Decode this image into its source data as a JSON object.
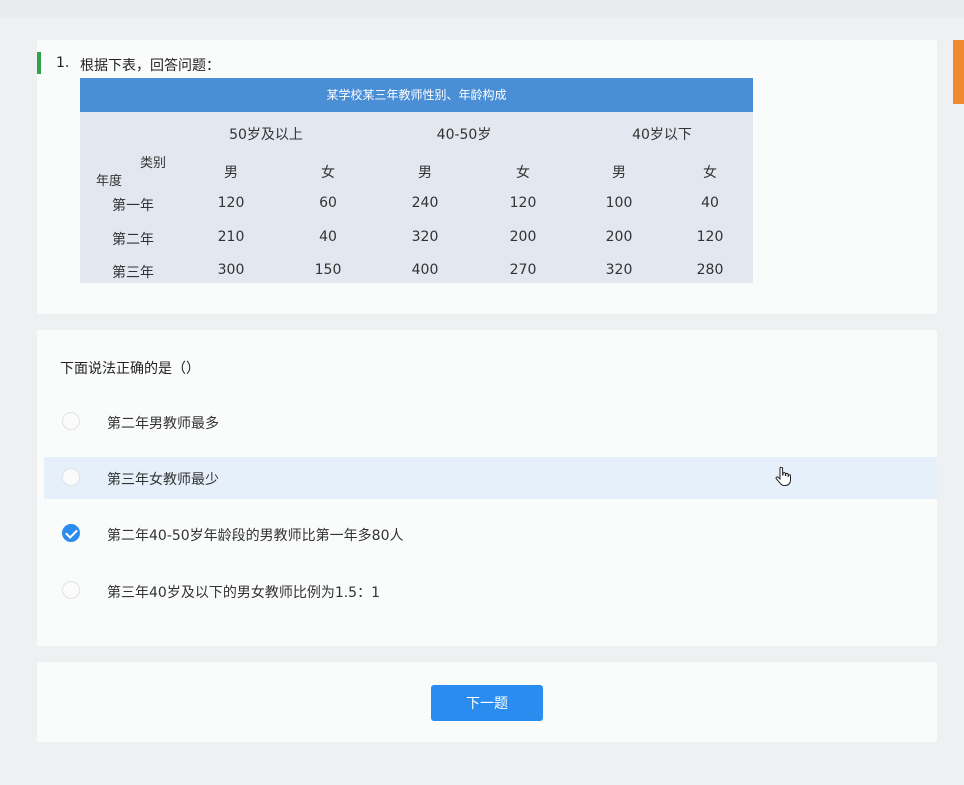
{
  "question": {
    "number": "1.",
    "prompt": "根据下表，回答问题："
  },
  "table": {
    "caption": "某学校某三年教师性别、年龄构成",
    "age_groups": [
      "50岁及以上",
      "40-50岁",
      "40岁以下"
    ],
    "header_corner": {
      "top": "类别",
      "bottom": "年度"
    },
    "genders": [
      "男",
      "女",
      "男",
      "女",
      "男",
      "女"
    ],
    "rows": [
      {
        "year": "第一年",
        "values": [
          "120",
          "60",
          "240",
          "120",
          "100",
          "40"
        ]
      },
      {
        "year": "第二年",
        "values": [
          "210",
          "40",
          "320",
          "200",
          "200",
          "120"
        ]
      },
      {
        "year": "第三年",
        "values": [
          "300",
          "150",
          "400",
          "270",
          "320",
          "280"
        ]
      }
    ]
  },
  "sub_question": "下面说法正确的是（）",
  "options": [
    {
      "label": "第二年男教师最多",
      "checked": false
    },
    {
      "label": "第三年女教师最少",
      "checked": false,
      "hovered": true
    },
    {
      "label": "第二年40-50岁年龄段的男教师比第一年多80人",
      "checked": true
    },
    {
      "label": "第三年40岁及以下的男女教师比例为1.5：1",
      "checked": false
    }
  ],
  "next_button_label": "下一题",
  "icons": {
    "cursor": "hand-pointer-icon",
    "checked": "check-circle-icon"
  },
  "colors": {
    "accent_blue": "#2a8cef",
    "table_header": "#4a8ed6",
    "table_body": "#e2e7f0",
    "question_marker": "#2fa24c",
    "side_tab": "#f08a30",
    "hover_row": "#e6f0fb"
  }
}
